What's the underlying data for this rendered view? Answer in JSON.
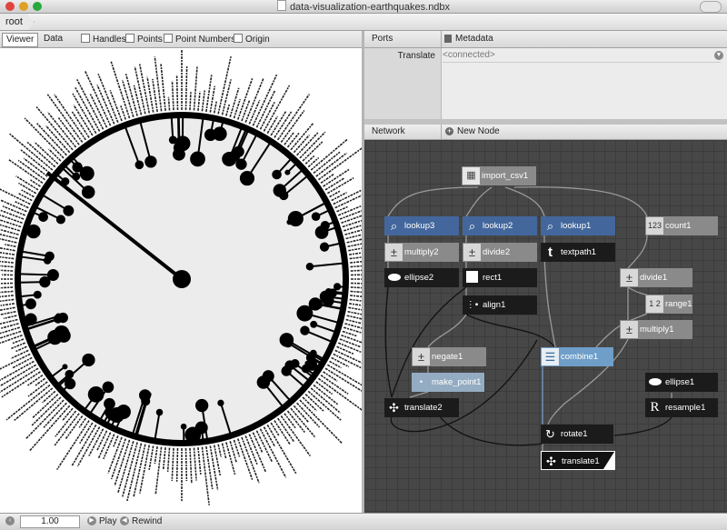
{
  "window": {
    "title": "data-visualization-earthquakes.ndbx"
  },
  "breadcrumb": {
    "root": "root"
  },
  "viewer_toolbar": {
    "tabs": [
      "Viewer",
      "Data"
    ],
    "checkboxes": [
      "Handles",
      "Points",
      "Point Numbers",
      "Origin"
    ]
  },
  "ports": {
    "header": "Ports",
    "metadata_label": "Metadata",
    "rows": [
      {
        "label": "Translate",
        "value": "<connected>"
      }
    ]
  },
  "network": {
    "header": "Network",
    "new_node_label": "New Node",
    "nodes": {
      "import_csv1": "import_csv1",
      "lookup3": "lookup3",
      "lookup2": "lookup2",
      "lookup1": "lookup1",
      "count1": "count1",
      "multiply2": "multiply2",
      "divide2": "divide2",
      "textpath1": "textpath1",
      "divide1": "divide1",
      "ellipse2": "ellipse2",
      "rect1": "rect1",
      "range1": "range1",
      "align1": "align1",
      "multiply1": "multiply1",
      "negate1": "negate1",
      "combine1": "combine1",
      "make_point1": "make_point1",
      "ellipse1": "ellipse1",
      "translate2": "translate2",
      "resample1": "resample1",
      "rotate1": "rotate1",
      "translate1": "translate1"
    }
  },
  "playback": {
    "frame": "1.00",
    "play_label": "Play",
    "rewind_label": "Rewind"
  },
  "colors": {
    "node_blue": "#43679c",
    "node_gray": "#8a8a8a",
    "node_black": "#1b1b1b",
    "node_cyan": "#6f9ec8",
    "network_bg": "#474747"
  }
}
